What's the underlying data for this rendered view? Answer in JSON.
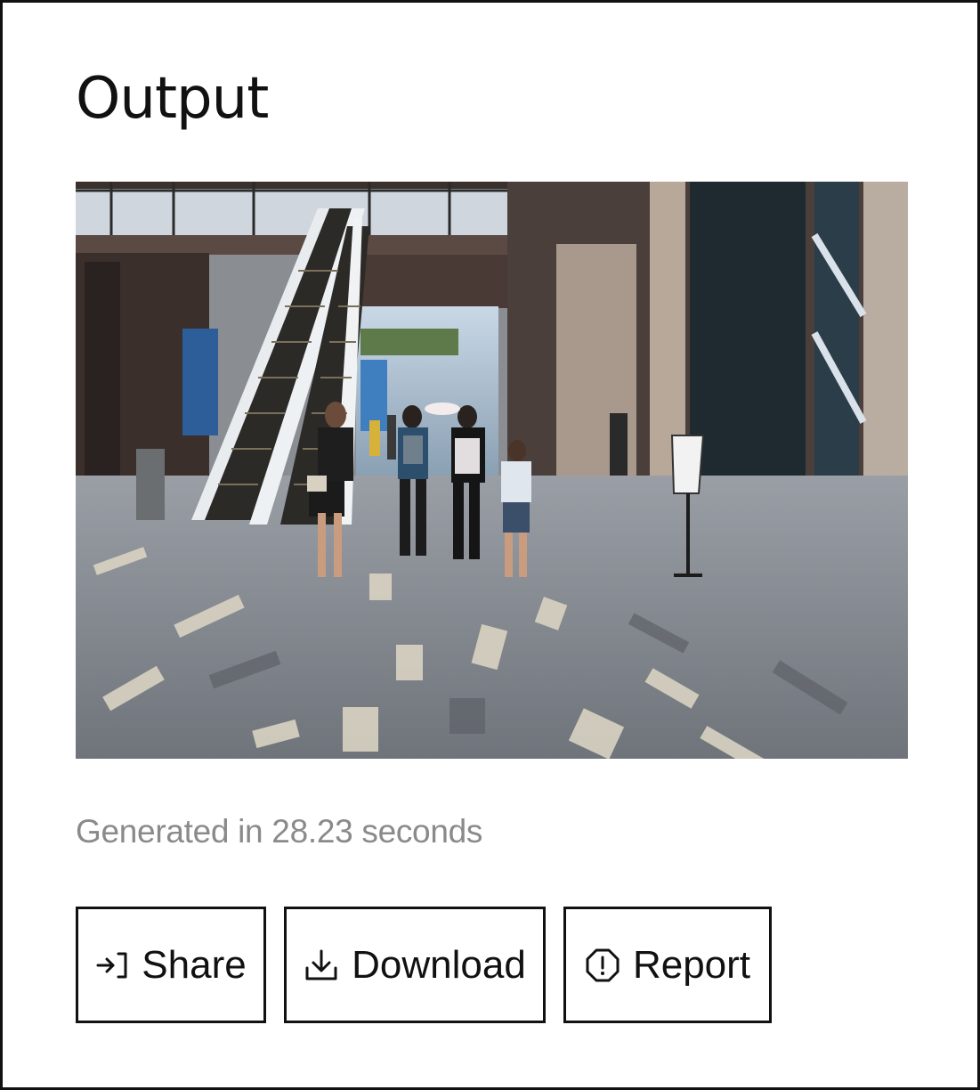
{
  "section": {
    "title": "Output"
  },
  "output": {
    "media_description": "Generated video frame of a shopping mall walkway with escalators and pedestrians"
  },
  "status": {
    "generated_text": "Generated in 28.23 seconds"
  },
  "actions": {
    "share_label": "Share",
    "download_label": "Download",
    "report_label": "Report"
  },
  "icons": {
    "share": "share-icon",
    "download": "download-icon",
    "report": "report-icon"
  },
  "colors": {
    "text": "#111111",
    "muted": "#8a8a8a",
    "border": "#111111",
    "background": "#ffffff"
  }
}
